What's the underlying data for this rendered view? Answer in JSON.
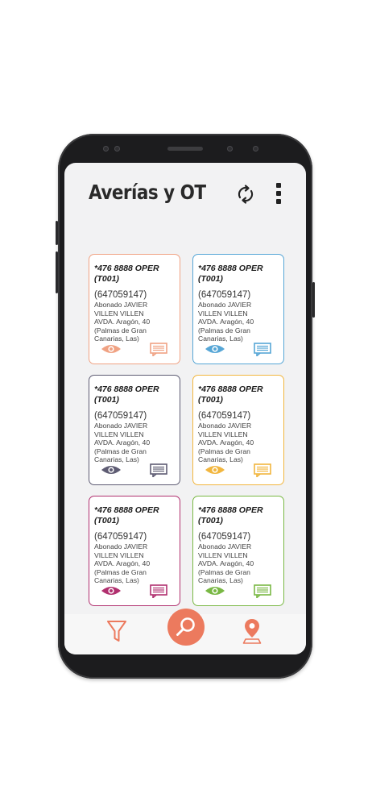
{
  "header": {
    "title": "Averías y OT",
    "refresh_icon": "refresh-icon",
    "menu_icon": "more-vertical-icon"
  },
  "cards": [
    {
      "code": "*476 8888 OPER (T001)",
      "phone": "(647059147)",
      "line1": "Abonado JAVIER",
      "line2": "VILLEN VILLEN",
      "line3": "AVDA. Aragón, 40",
      "line4": "(Palmas de Gran",
      "line5": "Canarias, Las)",
      "color": "#f0a283"
    },
    {
      "code": "*476 8888 OPER (T001)",
      "phone": "(647059147)",
      "line1": "Abonado JAVIER",
      "line2": "VILLEN VILLEN",
      "line3": "AVDA. Aragón, 40",
      "line4": "(Palmas de Gran",
      "line5": "Canarias, Las)",
      "color": "#56a6d6"
    },
    {
      "code": "*476 8888 OPER (T001)",
      "phone": "(647059147)",
      "line1": "Abonado JAVIER",
      "line2": "VILLEN VILLEN",
      "line3": "AVDA. Aragón, 40",
      "line4": "(Palmas de Gran",
      "line5": "Canarias, Las)",
      "color": "#5e5c73"
    },
    {
      "code": "*476 8888 OPER (T001)",
      "phone": "(647059147)",
      "line1": "Abonado JAVIER",
      "line2": "VILLEN VILLEN",
      "line3": "AVDA. Aragón, 40",
      "line4": "(Palmas de Gran",
      "line5": "Canarias, Las)",
      "color": "#f2b63e"
    },
    {
      "code": "*476 8888 OPER (T001)",
      "phone": "(647059147)",
      "line1": "Abonado JAVIER",
      "line2": "VILLEN VILLEN",
      "line3": "AVDA. Aragón, 40",
      "line4": "(Palmas de Gran",
      "line5": "Canarias, Las)",
      "color": "#b1306f"
    },
    {
      "code": "*476 8888 OPER (T001)",
      "phone": "(647059147)",
      "line1": "Abonado JAVIER",
      "line2": "VILLEN VILLEN",
      "line3": "AVDA. Aragón, 40",
      "line4": "(Palmas de Gran",
      "line5": "Canarias, Las)",
      "color": "#79b844"
    }
  ],
  "card_icons": {
    "view": "eye-icon",
    "message": "message-icon"
  },
  "bottom_nav": {
    "filter_icon": "filter-icon",
    "search_icon": "search-icon",
    "location_icon": "location-pin-icon",
    "accent": "#ec7a5e"
  }
}
